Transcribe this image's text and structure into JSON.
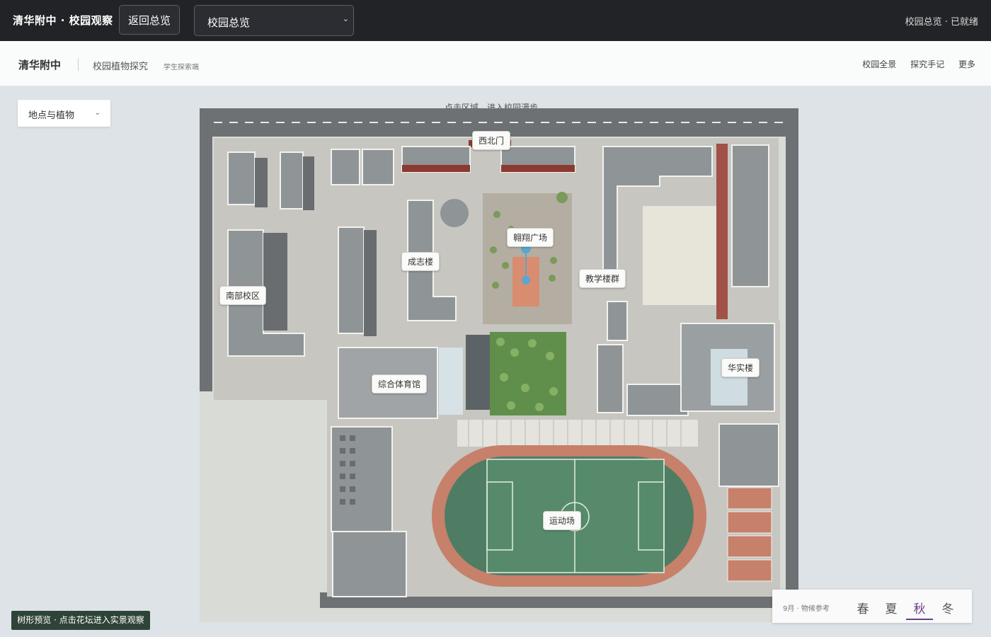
{
  "topbar": {
    "title": "清华附中 · 校园观察",
    "back_label": "返回总览",
    "view_select": "校园总览",
    "status": "校园总览 · 已就绪"
  },
  "subbar": {
    "school": "清华附中",
    "project": "校园植物探究",
    "role": "学生探索端",
    "nav": [
      "校园全景",
      "探究手记",
      "更多"
    ]
  },
  "filter": {
    "label": "地点与植物"
  },
  "hint": "点击区域，进入校园漫步",
  "map": {
    "labels": {
      "northwest_gate": "西北门",
      "plaza": "翱翔广场",
      "chengzhi": "成志楼",
      "south_campus": "南部校区",
      "teaching": "教学楼群",
      "huashi": "华实楼",
      "gym": "综合体育馆",
      "stadium": "运动场"
    }
  },
  "tree_hint": "树形预览 · 点击花坛进入实景观察",
  "season": {
    "month": "9月 · 物候参考",
    "options": [
      "春",
      "夏",
      "秋",
      "冬"
    ],
    "active": "秋"
  },
  "colors": {
    "topbar": "#222327",
    "accent": "#6b3e88",
    "field": "#4f7d63",
    "track": "#c7806a",
    "roof": "#8c9194"
  }
}
